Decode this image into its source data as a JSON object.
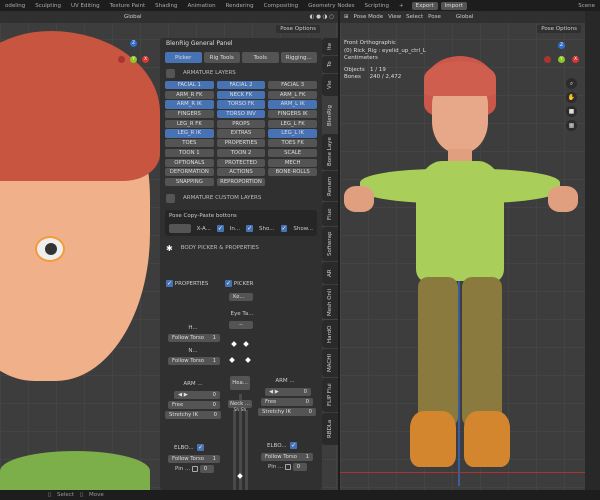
{
  "workspaces": [
    "odeling",
    "Sculpting",
    "UV Editing",
    "Texture Paint",
    "Shading",
    "Animation",
    "Rendering",
    "Compositing",
    "Geometry Nodes",
    "Scripting"
  ],
  "top_buttons": {
    "export": "Export",
    "import": "Import",
    "scene": "Scene"
  },
  "left_header": {
    "orientation": "Global",
    "pose_options": "Pose Options"
  },
  "right_header": {
    "mode": "Pose Mode",
    "menus": [
      "View",
      "Select",
      "Pose"
    ],
    "orientation": "Global",
    "pose_options": "Pose Options"
  },
  "panel": {
    "title": "BlenRig General Panel",
    "tabs": [
      {
        "label": "Picker",
        "active": true
      },
      {
        "label": "Rig Tools",
        "active": false
      },
      {
        "label": "Tools",
        "active": false
      },
      {
        "label": "Rigging...",
        "active": false
      }
    ],
    "armature_layers_header": "ARMATURE LAYERS",
    "layers": [
      {
        "label": "FACIAL 1",
        "on": true
      },
      {
        "label": "FACIAL 2",
        "on": true
      },
      {
        "label": "FACIAL 3",
        "on": false
      },
      {
        "label": "ARM_R FK",
        "on": false
      },
      {
        "label": "NECK FK",
        "on": true
      },
      {
        "label": "ARM_L FK",
        "on": false
      },
      {
        "label": "ARM_R IK",
        "on": true
      },
      {
        "label": "TORSO FK",
        "on": true
      },
      {
        "label": "ARM_L IK",
        "on": true
      },
      {
        "label": "FINGERS",
        "on": false
      },
      {
        "label": "TORSO INV",
        "on": true
      },
      {
        "label": "FINGERS IK",
        "on": false
      },
      {
        "label": "LEG_R FK",
        "on": false
      },
      {
        "label": "PROPS",
        "on": false
      },
      {
        "label": "LEG_L FK",
        "on": false
      },
      {
        "label": "LEG_R IK",
        "on": true
      },
      {
        "label": "EXTRAS",
        "on": false
      },
      {
        "label": "LEG_L IK",
        "on": true
      },
      {
        "label": "TOES",
        "on": false
      },
      {
        "label": "PROPERTIES",
        "on": false
      },
      {
        "label": "TOES FK",
        "on": false
      },
      {
        "label": "TOON 1",
        "on": false
      },
      {
        "label": "TOON 2",
        "on": false
      },
      {
        "label": "SCALE",
        "on": false
      },
      {
        "label": "OPTIONALS",
        "on": false
      },
      {
        "label": "PROTECTED",
        "on": false
      },
      {
        "label": "MECH",
        "on": false
      },
      {
        "label": "DEFORMATION",
        "on": false
      },
      {
        "label": "ACTIONS",
        "on": false
      },
      {
        "label": "BONE-ROLLS",
        "on": false
      },
      {
        "label": "SNAPPING",
        "on": false
      },
      {
        "label": "REPROPORTION",
        "on": false
      }
    ],
    "custom_layers_header": "ARMATURE CUSTOM LAYERS",
    "copy_paste": {
      "title": "Pose Copy-Paste bottons",
      "xa": "X-A...",
      "in": "In...",
      "sho": "Sho...",
      "show": "Show..."
    },
    "body_picker_header": "BODY PICKER & PROPERTIES",
    "properties_label": "PROPERTIES",
    "picker_label": "PICKER",
    "ke_button": "Ke...",
    "eye_target": "Eye Ta...",
    "eye_value": "--",
    "head_label": "H...",
    "neck_label": "N...",
    "follow_torso": "Follow Torso",
    "follow_torso_value": "1",
    "head_button": "Hea...",
    "neck_button": "Neck ...",
    "shoulders": "Sh Sh",
    "arm_r": {
      "label": "ARM ...",
      "value": "0",
      "free": "Free",
      "free_value": "0",
      "stretchy": "Stretchy IK",
      "stretchy_value": "0"
    },
    "arm_l": {
      "label": "ARM ...",
      "value": "0",
      "free": "Free",
      "free_value": "0",
      "stretchy": "Stretchy IK",
      "stretchy_value": "0"
    },
    "elbow_r": {
      "label": "ELBO...",
      "follow": "Follow Torso",
      "follow_value": "1",
      "pin": "Pin ...",
      "pin_value": "0"
    },
    "elbow_l": {
      "label": "ELBO...",
      "follow": "Follow Torso",
      "follow_value": "1",
      "pin": "Pin ...",
      "pin_value": "0"
    }
  },
  "side_tabs": [
    "Ite",
    "To",
    "Vie",
    "BlenRig",
    "Bone Laye",
    "Renam",
    "Flue",
    "Softwrap",
    "AR",
    "Mesh Onli",
    "HardO",
    "MACHI",
    "FLIP Flui",
    "RBDLa"
  ],
  "viewport_info": {
    "view": "Front Orthographic",
    "object": "(0) Rick_Rig : eyelid_up_ctrl_L",
    "units": "Centimeters",
    "objects_label": "Objects",
    "objects_value": "1 / 19",
    "bones_label": "Bones",
    "bones_value": "240 / 2,472"
  },
  "gizmo": {
    "z": "Z",
    "y": "Y",
    "x": "X"
  },
  "status": {
    "select": "Select",
    "move": "Move"
  }
}
